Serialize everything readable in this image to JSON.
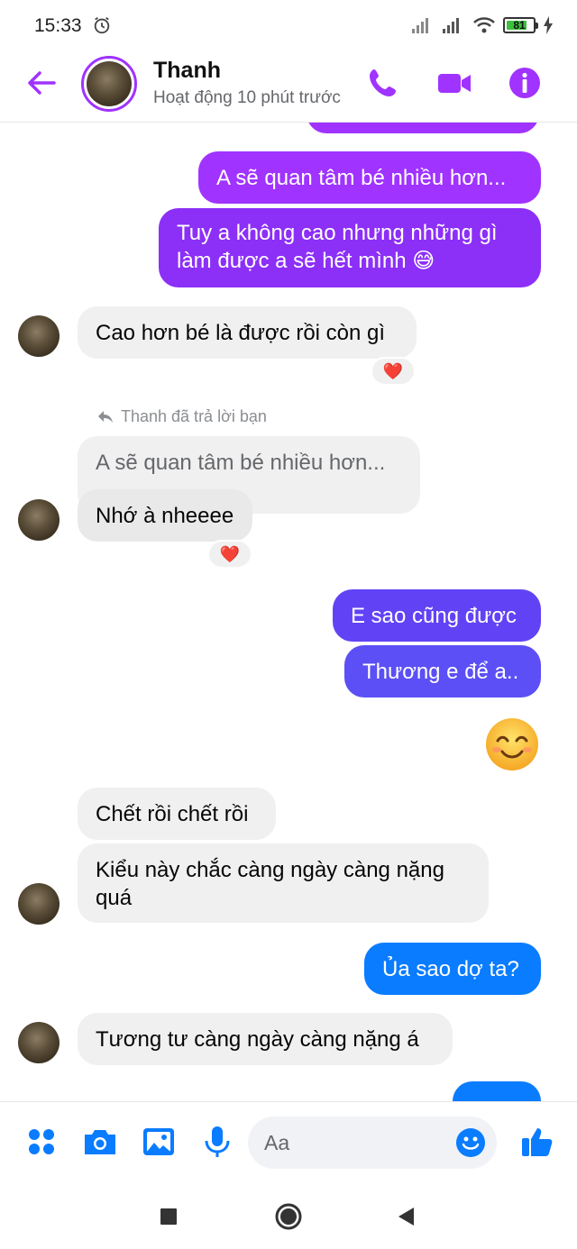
{
  "status_bar": {
    "time": "15:33",
    "battery": "81",
    "battery_level": 0.81
  },
  "header": {
    "contact_name": "Thanh",
    "contact_status": "Hoạt động 10 phút trước",
    "icons": [
      "back-arrow-icon",
      "phone-icon",
      "video-camera-icon",
      "info-icon"
    ],
    "accent_color": "#a033ff"
  },
  "messages": {
    "m1": "A sẽ quan tâm bé nhiều hơn...",
    "m2": "Tuy a không cao nhưng những gì\nlàm được a sẽ hết mình 😅",
    "m3": "Cao hơn bé là được rồi còn gì",
    "reply_label": "Thanh đã trả lời bạn",
    "quoted": "A sẽ quan tâm bé nhiều hơn...",
    "m4": "Nhớ à nheeee",
    "m5": "E sao cũng được",
    "m6": "Thương e để a..",
    "m7": "Chết rồi chết rồi",
    "m8": "Kiểu này chắc càng ngày càng nặng\nquá",
    "m9": "Ủa sao dợ ta?",
    "m10": "Tương tư càng ngày càng nặng á",
    "reaction": "❤️",
    "sticker_emoji": "smiling-face-icon"
  },
  "colors": {
    "gradient_purple": "#a033ff",
    "gradient_violet": "#7b3cf5",
    "gradient_indigo": "#5b4ff5",
    "gradient_blue": "#0a7cff",
    "incoming_bg": "#f0f0f0"
  },
  "composer": {
    "placeholder": "Aa",
    "icons": [
      "apps-icon",
      "camera-icon",
      "gallery-icon",
      "microphone-icon",
      "emoji-icon",
      "thumbs-up-icon"
    ]
  },
  "navbar": {
    "icons": [
      "recent-apps-icon",
      "home-icon",
      "back-icon"
    ]
  }
}
